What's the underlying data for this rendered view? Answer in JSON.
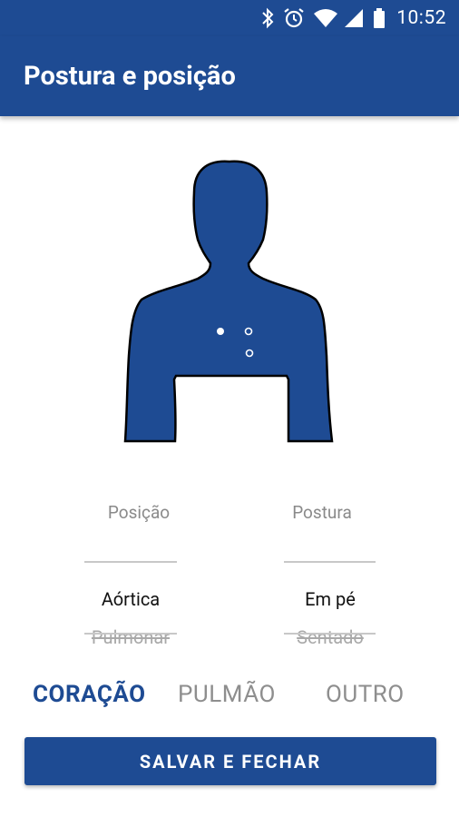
{
  "status_bar": {
    "time": "10:52",
    "icons": [
      "bluetooth-icon",
      "alarm-icon",
      "wifi-icon",
      "cellular-signal-icon",
      "battery-icon"
    ]
  },
  "app_bar": {
    "title": "Postura e posição"
  },
  "figure": {
    "body_color": "#1e4b93",
    "auscultation_points": [
      "filled",
      "outline",
      "outline",
      "outline"
    ]
  },
  "pickers": {
    "position": {
      "label": "Posição",
      "selected": "Aórtica",
      "next": "Pulmonar"
    },
    "posture": {
      "label": "Postura",
      "selected": "Em pé",
      "next": "Sentado"
    }
  },
  "tabs": [
    {
      "label": "CORAÇÃO",
      "active": true
    },
    {
      "label": "PULMÃO",
      "active": false
    },
    {
      "label": "OUTRO",
      "active": false
    }
  ],
  "save_button": {
    "label": "SALVAR E FECHAR"
  },
  "colors": {
    "primary": "#1e4b93",
    "muted": "#8e8e8e"
  }
}
